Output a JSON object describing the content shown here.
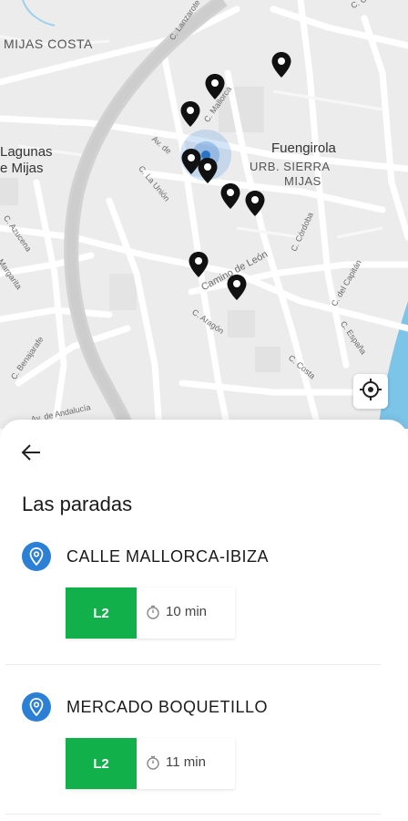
{
  "map": {
    "labels": {
      "mijas_costa": "MIJAS COSTA",
      "lagunas_line1": "Lagunas",
      "lagunas_line2": "e Mijas",
      "fuengirola": "Fuengirola",
      "urb_line1": "URB. SIERRA",
      "urb_line2": "MIJAS",
      "c_lanzarote": "C. Lanzarote",
      "c_mallorca": "C. Mallorca",
      "av_de": "Av. de",
      "c_la_union": "C. La Unión",
      "c_azucena": "C. Azucena",
      "margarita": "Margarita",
      "c_benajarafe": "C. Benajarafe",
      "av_andalucia": "Av. de Andalucía",
      "c_cordoba": "C. Córdoba",
      "c_aragon": "C. Aragón",
      "c_costa": "C. Costa",
      "c_espana": "C. España",
      "c_del_capitan": "C. del Capitán",
      "c_cubero": "C. Cubero",
      "camino_leon": "Camino de León"
    },
    "icons": {
      "pin": "map-pin-icon",
      "locate": "crosshair-icon"
    }
  },
  "sheet": {
    "back_icon": "arrow-left-icon",
    "title": "Las paradas",
    "stops": [
      {
        "name": "CALLE MALLORCA-IBIZA",
        "line": "L2",
        "eta": "10 min"
      },
      {
        "name": "MERCADO BOQUETILLO",
        "line": "L2",
        "eta": "11 min"
      }
    ]
  },
  "colors": {
    "line_badge": "#12b04a",
    "stop_icon": "#2b7fd4",
    "user_location": "#2a74c6"
  }
}
